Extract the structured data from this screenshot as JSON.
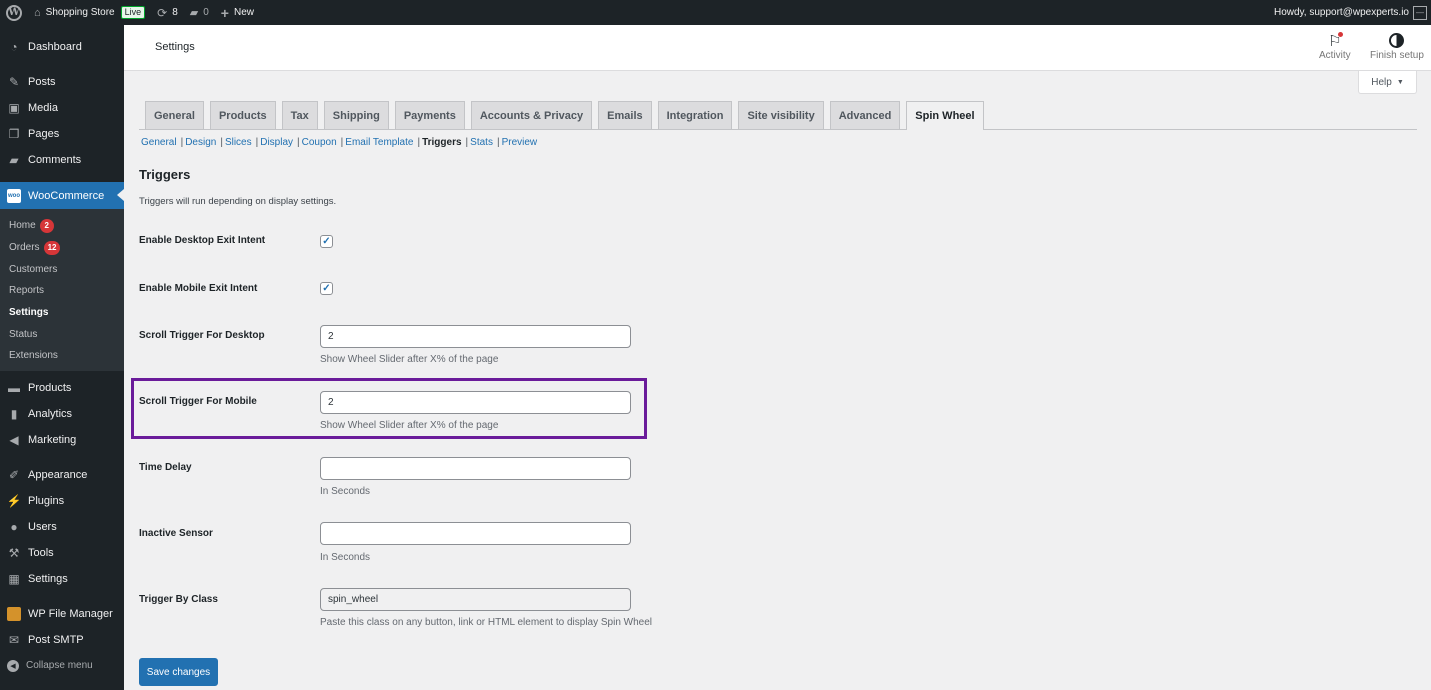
{
  "adminbar": {
    "site_name": "Shopping Store",
    "live_badge": "Live",
    "updates_count": "8",
    "comments_count": "0",
    "new_label": "New",
    "greeting": "Howdy, support@wpexperts.io"
  },
  "sidebar": {
    "top_items": [
      {
        "label": "Dashboard",
        "icon": "dashboard-icon"
      },
      {
        "label": "Posts",
        "icon": "pin-icon"
      },
      {
        "label": "Media",
        "icon": "media-icon"
      },
      {
        "label": "Pages",
        "icon": "pages-icon"
      },
      {
        "label": "Comments",
        "icon": "comment-icon"
      }
    ],
    "woocommerce": {
      "label": "WooCommerce",
      "icon": "woo-icon"
    },
    "woo_submenu": [
      {
        "label": "Home",
        "badge": "2"
      },
      {
        "label": "Orders",
        "badge": "12"
      },
      {
        "label": "Customers"
      },
      {
        "label": "Reports"
      },
      {
        "label": "Settings",
        "current": true
      },
      {
        "label": "Status"
      },
      {
        "label": "Extensions"
      }
    ],
    "mid_items": [
      {
        "label": "Products"
      },
      {
        "label": "Analytics"
      },
      {
        "label": "Marketing"
      }
    ],
    "admin_items": [
      {
        "label": "Appearance"
      },
      {
        "label": "Plugins"
      },
      {
        "label": "Users"
      },
      {
        "label": "Tools"
      },
      {
        "label": "Settings"
      }
    ],
    "plugin_items": [
      {
        "label": "WP File Manager"
      },
      {
        "label": "Post SMTP"
      }
    ],
    "collapse_label": "Collapse menu"
  },
  "header": {
    "title": "Settings",
    "activity_label": "Activity",
    "finish_setup_label": "Finish setup",
    "help_label": "Help"
  },
  "tabs": [
    {
      "label": "General"
    },
    {
      "label": "Products"
    },
    {
      "label": "Tax"
    },
    {
      "label": "Shipping"
    },
    {
      "label": "Payments"
    },
    {
      "label": "Accounts & Privacy"
    },
    {
      "label": "Emails"
    },
    {
      "label": "Integration"
    },
    {
      "label": "Site visibility"
    },
    {
      "label": "Advanced"
    },
    {
      "label": "Spin Wheel",
      "active": true
    }
  ],
  "subnav": [
    {
      "label": "General"
    },
    {
      "label": "Design"
    },
    {
      "label": "Slices"
    },
    {
      "label": "Display"
    },
    {
      "label": "Coupon"
    },
    {
      "label": "Email Template"
    },
    {
      "label": "Triggers",
      "current": true
    },
    {
      "label": "Stats"
    },
    {
      "label": "Preview"
    }
  ],
  "section": {
    "title": "Triggers",
    "description": "Triggers will run depending on display settings."
  },
  "fields": {
    "desktop_exit": {
      "label": "Enable Desktop Exit Intent",
      "checked": true
    },
    "mobile_exit": {
      "label": "Enable Mobile Exit Intent",
      "checked": true
    },
    "scroll_desktop": {
      "label": "Scroll Trigger For Desktop",
      "value": "2",
      "help": "Show Wheel Slider after X% of the page"
    },
    "scroll_mobile": {
      "label": "Scroll Trigger For Mobile",
      "value": "2",
      "help": "Show Wheel Slider after X% of the page"
    },
    "time_delay": {
      "label": "Time Delay",
      "value": "",
      "help": "In Seconds"
    },
    "inactive_sensor": {
      "label": "Inactive Sensor",
      "value": "",
      "help": "In Seconds"
    },
    "trigger_class": {
      "label": "Trigger By Class",
      "value": "spin_wheel",
      "help": "Paste this class on any button, link or HTML element to display Spin Wheel"
    }
  },
  "save_label": "Save changes",
  "colors": {
    "accent": "#2271b1",
    "highlight_border": "#6a1b9a",
    "badge": "#d63638"
  }
}
